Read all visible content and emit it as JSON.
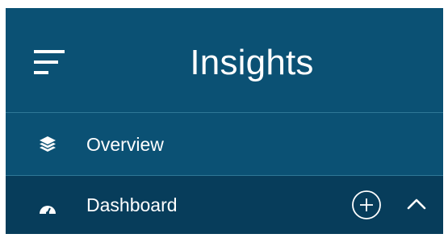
{
  "header": {
    "menu_icon": "hamburger-menu-icon",
    "title": "Insights"
  },
  "nav": {
    "items": [
      {
        "label": "Overview",
        "icon": "layers-icon",
        "selected": false
      },
      {
        "label": "Dashboard",
        "icon": "gauge-icon",
        "selected": true,
        "actions": [
          "plus-circle-icon",
          "chevron-up-icon"
        ]
      }
    ]
  },
  "colors": {
    "header_bg": "#0b5174",
    "selected_item_bg": "#073d5b",
    "divider": "#2f7796",
    "text": "#ffffff"
  }
}
